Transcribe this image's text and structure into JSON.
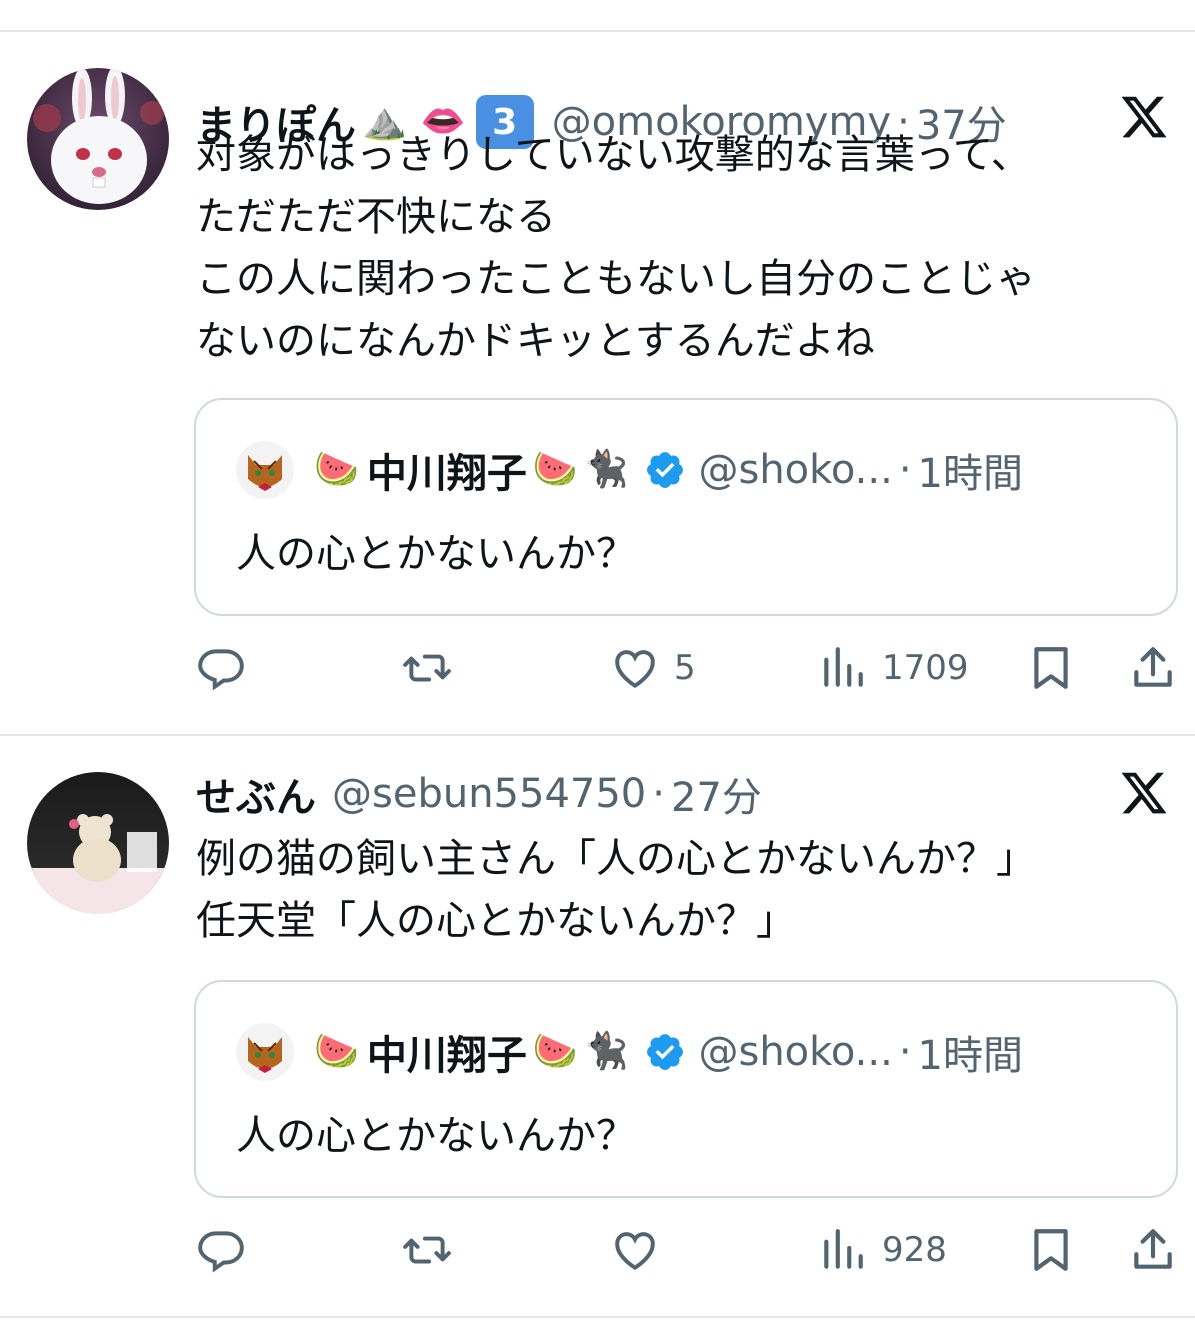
{
  "tweets": [
    {
      "display_name": "まりぽん",
      "name_emojis": [
        "⛰️",
        "👄"
      ],
      "keycap": "3",
      "handle": "@omokoromymy",
      "separator": "·",
      "time": "37分",
      "text_lines": [
        "対象がはっきりしていない攻撃的な言葉って、",
        "ただただ不快になる",
        "この人に関わったこともないし自分のことじゃ",
        "ないのになんかドキッとするんだよね"
      ],
      "quote": {
        "display_name": "中川翔子",
        "name_emoji_before": "🍉",
        "name_emojis_after": [
          "🍉",
          "🐈‍⬛"
        ],
        "handle": "@shoko...",
        "separator": "·",
        "time": "1時間",
        "text": "人の心とかないんか？"
      },
      "actions": {
        "reply_count": "",
        "retweet_count": "",
        "like_count": "5",
        "view_count": "1709"
      }
    },
    {
      "display_name": "せぶん",
      "handle": "@sebun554750",
      "separator": "·",
      "time": "27分",
      "text_lines": [
        "例の猫の飼い主さん「人の心とかないんか？」",
        "任天堂「人の心とかないんか？」"
      ],
      "quote": {
        "display_name": "中川翔子",
        "name_emoji_before": "🍉",
        "name_emojis_after": [
          "🍉",
          "🐈‍⬛"
        ],
        "handle": "@shoko...",
        "separator": "·",
        "time": "1時間",
        "text": "人の心とかないんか？"
      },
      "actions": {
        "reply_count": "",
        "retweet_count": "",
        "like_count": "",
        "view_count": "928"
      }
    }
  ],
  "colors": {
    "text_primary": "#0f1419",
    "text_secondary": "#536471",
    "border": "#cfd9de",
    "divider": "#e4e7ea",
    "verified": "#1d9bf0"
  },
  "icons": [
    "x-logo-icon",
    "reply-icon",
    "retweet-icon",
    "like-icon",
    "views-icon",
    "bookmark-icon",
    "share-icon",
    "verified-badge-icon"
  ]
}
